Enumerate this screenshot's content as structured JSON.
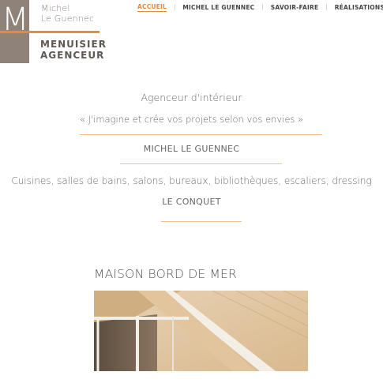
{
  "logo": {
    "monogram": "MLG",
    "name_line1": "Michel",
    "name_line2": "Le Guennec",
    "tagline_line1": "MENUISIER",
    "tagline_line2": "AGENCEUR",
    "colors": {
      "grey": "#8e8279",
      "accent": "#e68a3c"
    }
  },
  "nav": {
    "items": [
      {
        "label": "ACCUEIL",
        "active": true
      },
      {
        "label": "MICHEL LE GUENNEC",
        "active": false
      },
      {
        "label": "SAVOIR-FAIRE",
        "active": false
      },
      {
        "label": "RÉALISATIONS",
        "active": false
      }
    ],
    "separator": "|"
  },
  "intro": {
    "subtitle": "Agenceur d'intérieur",
    "quote": "« J'imagine et crée vos projets selon vos envies »",
    "name": "MICHEL LE GUENNEC",
    "services": "Cuisines, salles de bains, salons, bureaux, bibliothèques, escaliers, dressing",
    "place": "LE CONQUET"
  },
  "project": {
    "title": "MAISON BORD DE MER"
  },
  "colors": {
    "accent": "#e68a3c",
    "rule": "#f0c08e",
    "text": "#666666"
  }
}
